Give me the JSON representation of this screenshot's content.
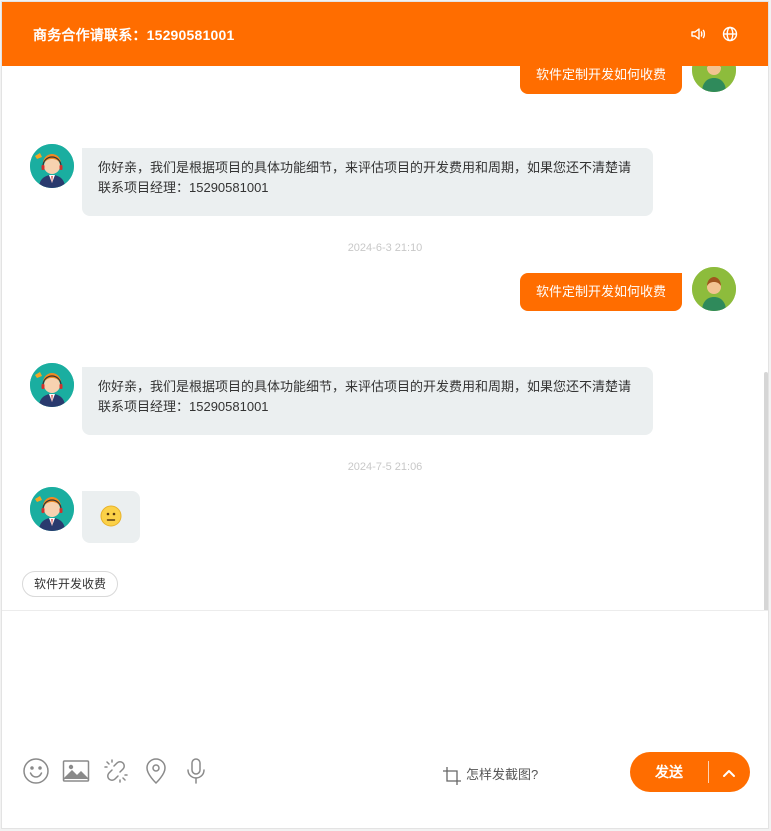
{
  "header": {
    "title": "商务合作请联系：15290581001",
    "icons": [
      "speaker-icon",
      "globe-icon"
    ]
  },
  "messages": [
    {
      "side": "user",
      "text": "软件定制开发如何收费"
    },
    {
      "side": "agent",
      "text": "你好亲，我们是根据项目的具体功能细节，来评估项目的开发费用和周期，如果您还不清楚请联系项目经理：15290581001"
    },
    {
      "side": "timestamp",
      "text": "2024-6-3 21:10"
    },
    {
      "side": "user",
      "text": "软件定制开发如何收费"
    },
    {
      "side": "agent",
      "text": "你好亲，我们是根据项目的具体功能细节，来评估项目的开发费用和周期，如果您还不清楚请联系项目经理：15290581001"
    },
    {
      "side": "timestamp",
      "text": "2024-7-5 21:06"
    },
    {
      "side": "agent",
      "emoji": "confused-face"
    }
  ],
  "quick_reply": "软件开发收费",
  "input": {
    "value": "",
    "placeholder": ""
  },
  "toolbar": {
    "icons": [
      "emoji-icon",
      "image-icon",
      "link-icon",
      "location-icon",
      "microphone-icon"
    ],
    "screenshot_tip": "怎样发截图?"
  },
  "send": {
    "label": "发送"
  },
  "colors": {
    "accent": "#ff6d00",
    "agent_bubble": "#ebeff0"
  }
}
